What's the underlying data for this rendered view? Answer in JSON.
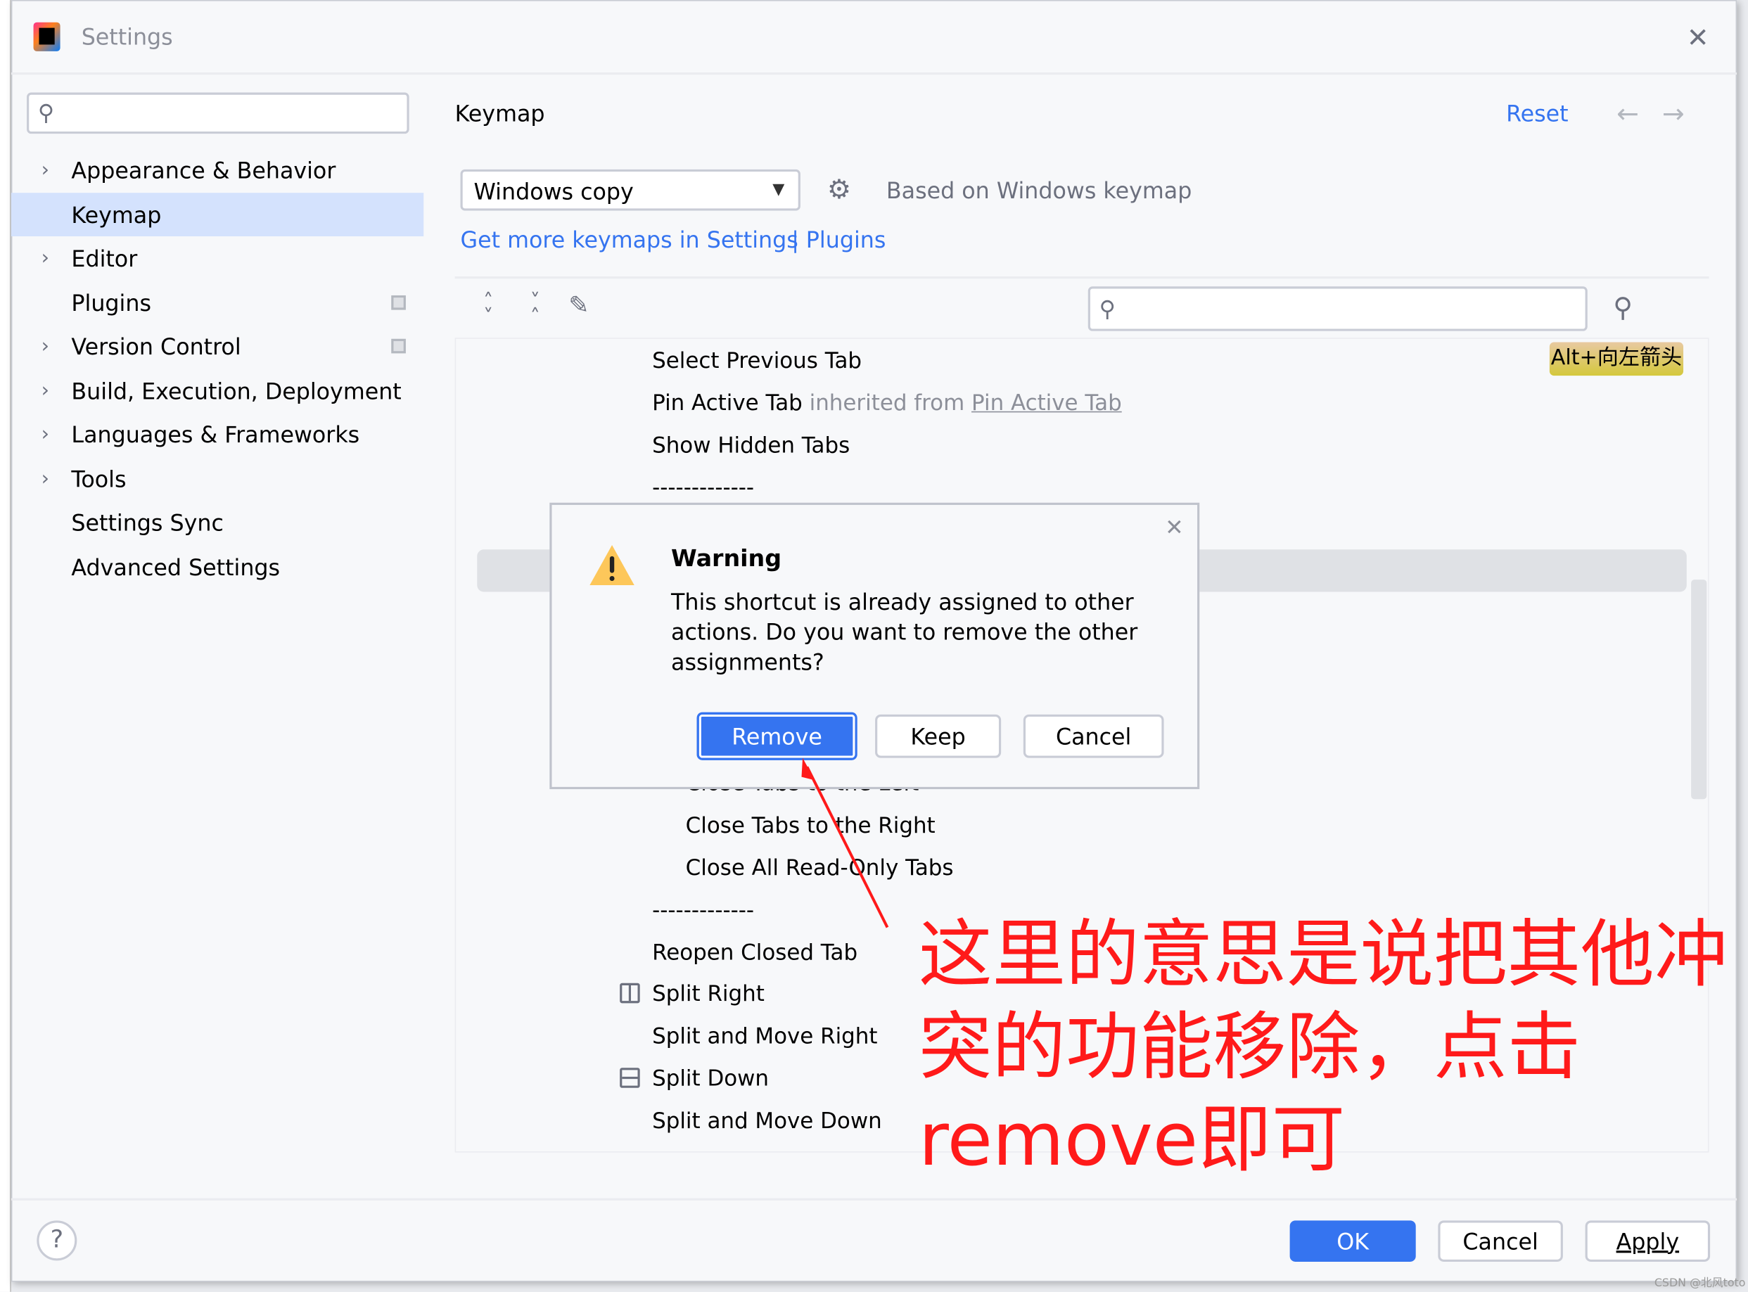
{
  "window": {
    "title": "Settings",
    "close_icon": "close-icon"
  },
  "sidebar": {
    "search_placeholder": "",
    "items": [
      {
        "label": "Appearance & Behavior",
        "expandable": true
      },
      {
        "label": "Keymap",
        "selected": true
      },
      {
        "label": "Editor",
        "expandable": true
      },
      {
        "label": "Plugins",
        "badge": true
      },
      {
        "label": "Version Control",
        "expandable": true,
        "badge": true
      },
      {
        "label": "Build, Execution, Deployment",
        "expandable": true
      },
      {
        "label": "Languages & Frameworks",
        "expandable": true
      },
      {
        "label": "Tools",
        "expandable": true
      },
      {
        "label": "Settings Sync"
      },
      {
        "label": "Advanced Settings"
      }
    ]
  },
  "main": {
    "title": "Keymap",
    "reset": "Reset",
    "keymap_select": "Windows copy",
    "based_on": "Based on Windows keymap",
    "link_get_more": "Get more keymaps in Settings",
    "link_separator": "|",
    "link_plugins": "Plugins",
    "search_placeholder": "",
    "tree": {
      "row1": "Select Previous Tab",
      "row1_shortcut": "Alt+向左箭头",
      "row2": "Pin Active Tab",
      "row2_inherited": "inherited from",
      "row2_link": "Pin Active Tab",
      "row3": "Show Hidden Tabs",
      "sep1": "-------------",
      "row_hidden": "Close Tabs to the Left",
      "row4": "Close Tabs to the Right",
      "row5": "Close All Read-Only Tabs",
      "sep2": "-------------",
      "row6": "Reopen Closed Tab",
      "row7": "Split Right",
      "row8": "Split and Move Right",
      "row9": "Split Down",
      "row10": "Split and Move Down"
    }
  },
  "dialog": {
    "title": "Warning",
    "message": [
      "This shortcut is already assigned to other",
      "actions. Do you want to remove the other",
      "assignments?"
    ],
    "remove": "Remove",
    "keep": "Keep",
    "cancel": "Cancel"
  },
  "footer": {
    "help": "?",
    "ok": "OK",
    "cancel": "Cancel",
    "apply": "Apply"
  },
  "annotation": {
    "lines": [
      "这里的意思是说把其他冲",
      "突的功能移除，点击",
      "remove即可"
    ],
    "color": "#ff1a1a"
  },
  "watermark": "CSDN @北风toto",
  "colors": {
    "accent": "#3574f0",
    "selection": "#d4e2fd",
    "shortcut_badge": "#d9c944"
  }
}
